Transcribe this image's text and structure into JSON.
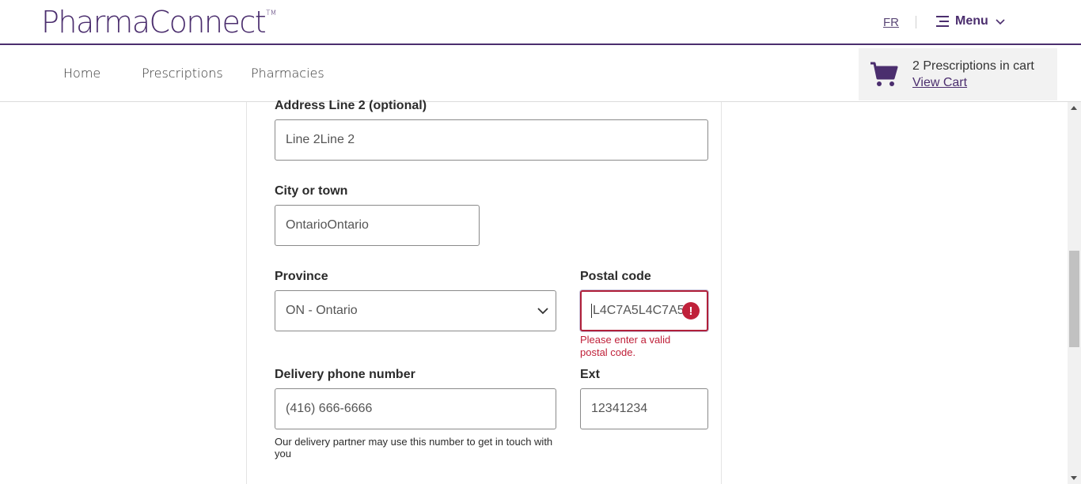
{
  "header": {
    "logo_text": "PharmaConnect",
    "logo_tm": "TM",
    "lang_label": "FR",
    "menu_label": "Menu"
  },
  "nav": {
    "items": [
      "Home",
      "Prescriptions",
      "Pharmacies"
    ]
  },
  "cart": {
    "count_text": "2 Prescriptions in cart",
    "view_label": "View Cart"
  },
  "form": {
    "address2": {
      "label": "Address Line 2 (optional)",
      "value": "Line 2Line 2"
    },
    "city": {
      "label": "City or town",
      "value": "OntarioOntario"
    },
    "province": {
      "label": "Province",
      "value": "ON - Ontario"
    },
    "postal": {
      "label": "Postal code",
      "value": "L4C7A5L4C7A5",
      "error": "Please enter a valid postal code."
    },
    "phone": {
      "label": "Delivery phone number",
      "value": "(416) 666-6666",
      "help": "Our delivery partner may use this number to get in touch with you"
    },
    "ext": {
      "label": "Ext",
      "value": "12341234"
    }
  },
  "colors": {
    "brand": "#4b2e6e",
    "error": "#c0213a"
  },
  "icons": [
    "menu-icon",
    "chevron-down-icon",
    "cart-icon",
    "error-icon"
  ]
}
